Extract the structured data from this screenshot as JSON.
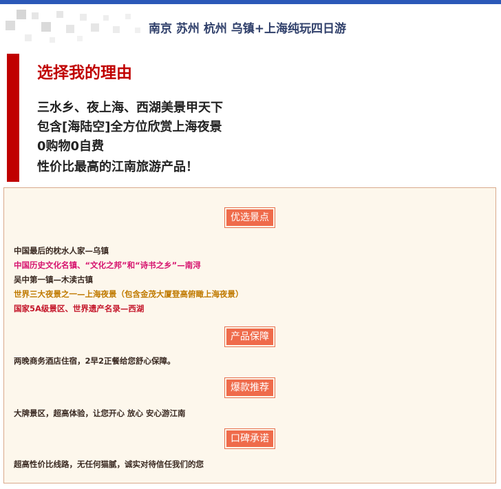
{
  "header": {
    "title": "南京 苏州 杭州 乌镇+上海纯玩四日游",
    "accent": "#2b58b8"
  },
  "reasons": {
    "heading": "选择我的理由",
    "lines": [
      "三水乡、夜上海、西湖美景甲天下",
      "包含[海陆空]全方位欣赏上海夜景",
      "0购物0自费",
      "性价比最高的江南旅游产品！"
    ],
    "accent": "#c00000"
  },
  "sections": {
    "spots": {
      "title": "优选景点",
      "items": [
        "中国最后的枕水人家—乌镇",
        "中国历史文化名镇、“文化之邦”和“诗书之乡”—南浔",
        "吴中第一镇—木渎古镇",
        "世界三大夜景之一—上海夜景（包含金茂大厦登高俯瞰上海夜景）",
        "国家5A级景区、世界遗产名录—西湖"
      ]
    },
    "guarantee": {
      "title": "产品保障",
      "text": "两晚商务酒店住宿，2早2正餐给您舒心保障。"
    },
    "hot": {
      "title": "爆款推荐",
      "text": "大牌景区，超高体验，让您开心 放心 安心游江南"
    },
    "reputation": {
      "title": "口碑承诺",
      "text": "超高性价比线路，无任何猫腻，诚实对待信任我们的您"
    }
  }
}
